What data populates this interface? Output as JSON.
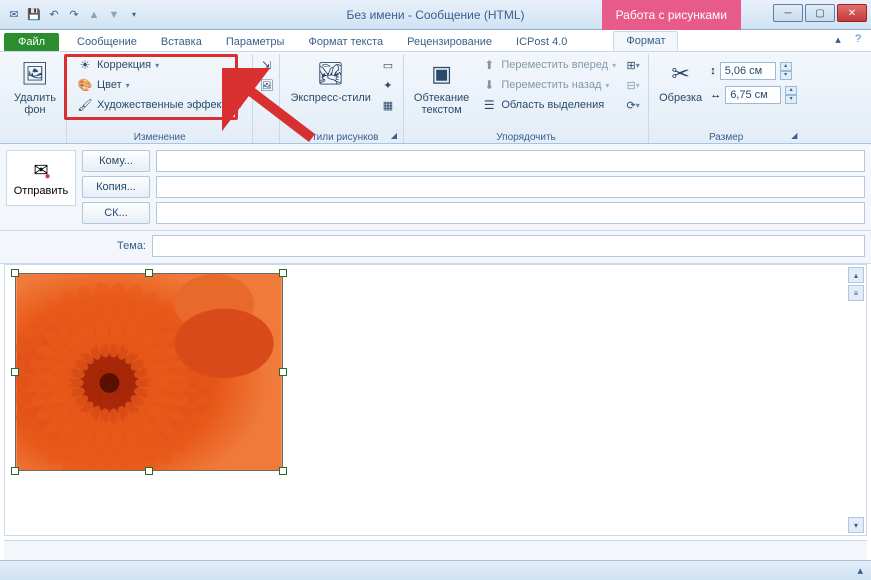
{
  "window": {
    "title": "Без имени  -  Сообщение (HTML)",
    "contextual_tab": "Работа с рисунками"
  },
  "tabs": {
    "file": "Файл",
    "items": [
      "Сообщение",
      "Вставка",
      "Параметры",
      "Формат текста",
      "Рецензирование",
      "ICPost 4.0"
    ],
    "format": "Формат"
  },
  "ribbon": {
    "remove_bg": {
      "label": "Удалить\nфон"
    },
    "adjust": {
      "correction": "Коррекция",
      "color": "Цвет",
      "artistic": "Художественные эффекты",
      "group_label": "Изменение"
    },
    "styles": {
      "express": "Экспресс-стили",
      "group_label": "Стили рисунков"
    },
    "arrange": {
      "wrap": "Обтекание\nтекстом",
      "forward": "Переместить вперед",
      "backward": "Переместить назад",
      "selection_pane": "Область выделения",
      "group_label": "Упорядочить"
    },
    "size": {
      "crop": "Обрезка",
      "height": "5,06 см",
      "width": "6,75 см",
      "group_label": "Размер"
    }
  },
  "mail": {
    "send": "Отправить",
    "to": "Кому...",
    "cc": "Копия...",
    "bcc": "СК...",
    "subject_label": "Тема:"
  }
}
